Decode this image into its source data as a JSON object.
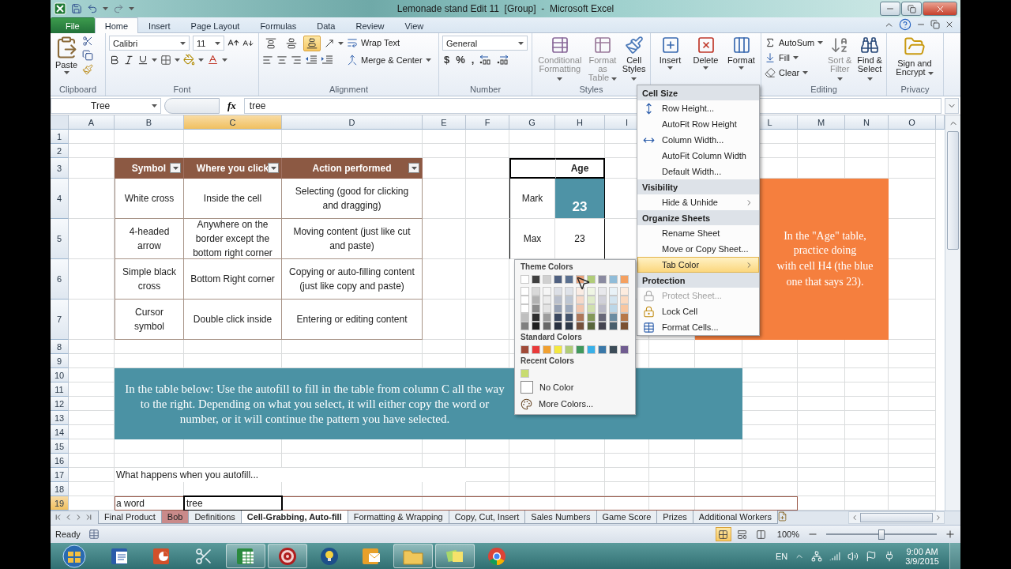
{
  "window": {
    "title": "Lemonade stand Edit 11  [Group]  -  Microsoft Excel"
  },
  "ribbon_tabs": [
    {
      "label": "File",
      "kind": "file",
      "selected": false
    },
    {
      "label": "Home",
      "kind": "tab",
      "selected": true
    },
    {
      "label": "Insert",
      "kind": "tab",
      "selected": false
    },
    {
      "label": "Page Layout",
      "kind": "tab",
      "selected": false
    },
    {
      "label": "Formulas",
      "kind": "tab",
      "selected": false
    },
    {
      "label": "Data",
      "kind": "tab",
      "selected": false
    },
    {
      "label": "Review",
      "kind": "tab",
      "selected": false
    },
    {
      "label": "View",
      "kind": "tab",
      "selected": false
    }
  ],
  "clipboard": {
    "label": "Clipboard",
    "paste": "Paste"
  },
  "font": {
    "label": "Font",
    "name": "Calibri",
    "size": "11"
  },
  "alignment": {
    "label": "Alignment",
    "vertical": [
      {
        "kind": "top",
        "selected": false
      },
      {
        "kind": "middle",
        "selected": false
      },
      {
        "kind": "bottom",
        "selected": true
      }
    ],
    "wrap_text": "Wrap Text",
    "merge_center": "Merge & Center"
  },
  "number": {
    "label": "Number",
    "format": "General",
    "symbols": [
      "$",
      "%",
      ","
    ]
  },
  "styles": {
    "label": "Styles",
    "buttons": [
      {
        "label": "Conditional Formatting",
        "kind": "conditional",
        "disabled": true
      },
      {
        "label": "Format as Table",
        "kind": "table",
        "disabled": true
      },
      {
        "label": "Cell Styles",
        "kind": "cellstyles",
        "disabled": false
      }
    ]
  },
  "cells_group": {
    "buttons": [
      {
        "label": "Insert",
        "kind": "insert"
      },
      {
        "label": "Delete",
        "kind": "delete"
      },
      {
        "label": "Format",
        "kind": "format"
      }
    ]
  },
  "editing": {
    "label": "Editing",
    "small_buttons": [
      {
        "label": "AutoSum",
        "kind": "sum"
      },
      {
        "label": "Fill",
        "kind": "fill"
      },
      {
        "label": "Clear",
        "kind": "clear"
      }
    ],
    "big_buttons": [
      {
        "label": "Sort & Filter",
        "kind": "sort",
        "disabled": true
      },
      {
        "label": "Find & Select",
        "kind": "find",
        "disabled": false
      }
    ]
  },
  "privacy": {
    "label": "Privacy",
    "button": "Sign and Encrypt"
  },
  "formula_bar": {
    "name_box": "Tree",
    "fx": "fx",
    "formula": "tree"
  },
  "columns": [
    {
      "label": "A",
      "selected": false
    },
    {
      "label": "B",
      "selected": false
    },
    {
      "label": "C",
      "selected": true
    },
    {
      "label": "D",
      "selected": false
    },
    {
      "label": "E",
      "selected": false
    },
    {
      "label": "F",
      "selected": false
    },
    {
      "label": "G",
      "selected": false
    },
    {
      "label": "H",
      "selected": false
    },
    {
      "label": "I",
      "selected": false
    },
    {},
    {},
    {
      "label": "L",
      "selected": false
    },
    {
      "label": "M",
      "selected": false
    },
    {
      "label": "N",
      "selected": false
    },
    {
      "label": "O",
      "selected": false
    }
  ],
  "rows": [
    {
      "label": "1",
      "selected": false
    },
    {
      "label": "2",
      "selected": false
    },
    {
      "label": "3",
      "selected": false
    },
    {
      "label": "4",
      "selected": false
    },
    {
      "label": "5",
      "selected": false
    },
    {
      "label": "6",
      "selected": false
    },
    {
      "label": "7",
      "selected": false
    },
    {
      "label": "8",
      "selected": false
    },
    {
      "label": "9",
      "selected": false
    },
    {
      "label": "10",
      "selected": false
    },
    {
      "label": "11",
      "selected": false
    },
    {
      "label": "12",
      "selected": false
    },
    {
      "label": "13",
      "selected": false
    },
    {
      "label": "14",
      "selected": false
    },
    {
      "label": "15",
      "selected": false
    },
    {
      "label": "16",
      "selected": false
    },
    {
      "label": "17",
      "selected": false
    },
    {
      "label": "18",
      "selected": false
    },
    {
      "label": "19",
      "selected": true
    }
  ],
  "symbol_table": {
    "headers": [
      "Symbol",
      "Where you click",
      "Action performed"
    ],
    "rows": [
      [
        "White cross",
        "Inside the cell",
        "Selecting (good for clicking and dragging)"
      ],
      [
        "4-headed arrow",
        "Anywhere on the border except the bottom right corner",
        "Moving content (just like cut and paste)"
      ],
      [
        "Simple black cross",
        "Bottom Right corner",
        "Copying or auto-filling content (just like copy and paste)"
      ],
      [
        "Cursor symbol",
        "Double click inside",
        "Entering or editing content"
      ]
    ]
  },
  "age_table": {
    "header": "Age",
    "rows": [
      {
        "name": "Mark",
        "value": "23",
        "highlighted": true
      },
      {
        "name": "Max",
        "value": "23",
        "highlighted": false
      }
    ]
  },
  "instructions": "In the table below: Use the autofill to fill in the table from column C all the way to the right. Depending on what you select, it will either copy the word or number, or it will continue the pattern you have selected.",
  "note_lines": [
    "In the \"Age\" table, practice doing",
    "with cell H4 (the blue",
    "one that says 23)."
  ],
  "prompt": "What happens when you autofill...",
  "row19": [
    "a word",
    "tree"
  ],
  "format_menu": {
    "sections": [
      {
        "heading": "Cell Size",
        "items": [
          {
            "label": "Row Height...",
            "kind": "rowheight",
            "selected": false,
            "disabled": false,
            "submenu": false
          },
          {
            "label": "AutoFit Row Height",
            "kind": "plain",
            "selected": false,
            "disabled": false,
            "submenu": false
          },
          {
            "label": "Column Width...",
            "kind": "colwidth",
            "selected": false,
            "disabled": false,
            "submenu": false
          },
          {
            "label": "AutoFit Column Width",
            "kind": "plain",
            "selected": false,
            "disabled": false,
            "submenu": false
          },
          {
            "label": "Default Width...",
            "kind": "plain",
            "selected": false,
            "disabled": false,
            "submenu": false
          }
        ]
      },
      {
        "heading": "Visibility",
        "items": [
          {
            "label": "Hide & Unhide",
            "kind": "plain",
            "selected": false,
            "disabled": false,
            "submenu": true
          }
        ]
      },
      {
        "heading": "Organize Sheets",
        "items": [
          {
            "label": "Rename Sheet",
            "kind": "plain",
            "selected": false,
            "disabled": false,
            "submenu": false
          },
          {
            "label": "Move or Copy Sheet...",
            "kind": "plain",
            "selected": false,
            "disabled": false,
            "submenu": false
          },
          {
            "label": "Tab Color",
            "kind": "plain",
            "selected": true,
            "disabled": false,
            "submenu": true
          }
        ]
      },
      {
        "heading": "Protection",
        "items": [
          {
            "label": "Protect Sheet...",
            "kind": "protect",
            "selected": false,
            "disabled": true,
            "submenu": false
          },
          {
            "label": "Lock Cell",
            "kind": "lock",
            "selected": false,
            "disabled": false,
            "submenu": false
          },
          {
            "label": "Format Cells...",
            "kind": "format",
            "selected": false,
            "disabled": false,
            "submenu": false
          }
        ]
      }
    ]
  },
  "tab_color_palette": {
    "theme_heading": "Theme Colors",
    "theme_colors": [
      {
        "color": "#ffffff"
      },
      {
        "color": "#3f3f3f"
      },
      {
        "color": "#d0d0d0"
      },
      {
        "color": "#4f6080"
      },
      {
        "color": "#5a7090"
      },
      {
        "color": "#e8a078"
      },
      {
        "color": "#b0cc78"
      },
      {
        "color": "#8a8aa0"
      },
      {
        "color": "#90bcd8"
      },
      {
        "color": "#f4a060"
      }
    ],
    "standard_heading": "Standard Colors",
    "standard_colors": [
      {
        "color": "#a04a38"
      },
      {
        "color": "#e83a3a"
      },
      {
        "color": "#f0a030"
      },
      {
        "color": "#f4e840"
      },
      {
        "color": "#b0cc78"
      },
      {
        "color": "#40985c"
      },
      {
        "color": "#38b0e8"
      },
      {
        "color": "#3a78a8"
      },
      {
        "color": "#3c4c58"
      },
      {
        "color": "#705c90"
      }
    ],
    "recent_heading": "Recent Colors",
    "recent_colors": [
      {
        "color": "#c8dc70"
      }
    ],
    "no_color": "No Color",
    "more_colors": "More Colors..."
  },
  "sheet_tabs": [
    {
      "label": "Final Product",
      "selected": false
    },
    {
      "label": "Bob",
      "selected": false,
      "color": "#c98a8a"
    },
    {
      "label": "Definitions",
      "selected": false
    },
    {
      "label": "Cell-Grabbing, Auto-fill",
      "selected": true
    },
    {
      "label": "Formatting & Wrapping",
      "selected": false
    },
    {
      "label": "Copy, Cut, Insert",
      "selected": false
    },
    {
      "label": "Sales Numbers",
      "selected": false
    },
    {
      "label": "Game Score",
      "selected": false
    },
    {
      "label": "Prizes",
      "selected": false
    },
    {
      "label": "Additional Workers",
      "selected": false
    }
  ],
  "status_bar": {
    "text": "Ready",
    "views": [
      {
        "kind": "normal",
        "selected": true
      },
      {
        "kind": "layout",
        "selected": false
      },
      {
        "kind": "pagebreak",
        "selected": false
      }
    ],
    "zoom": "100%",
    "level": 0.5
  },
  "taskbar": {
    "apps": [
      {
        "kind": "word",
        "open": false
      },
      {
        "kind": "powerpoint",
        "open": false
      },
      {
        "kind": "snipping",
        "open": false
      },
      {
        "kind": "excel",
        "open": true
      },
      {
        "kind": "target",
        "open": true
      },
      {
        "kind": "bulb",
        "open": false
      },
      {
        "kind": "outlook",
        "open": false
      },
      {
        "kind": "explorer",
        "open": true
      },
      {
        "kind": "notes",
        "open": true
      },
      {
        "kind": "chrome",
        "open": false
      }
    ],
    "language": "EN",
    "time": "9:00 AM",
    "date": "3/9/2015"
  }
}
